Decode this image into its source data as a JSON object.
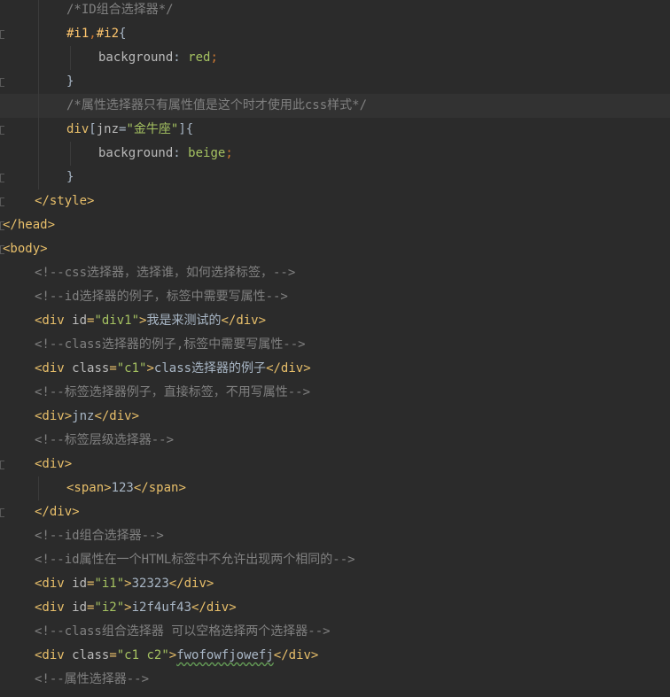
{
  "editor": {
    "lines": [
      {
        "indent": 2,
        "tokens": [
          {
            "t": "comment",
            "v": "/*ID组合选择器*/"
          }
        ]
      },
      {
        "indent": 2,
        "fold": true,
        "tokens": [
          {
            "t": "sel",
            "v": "#i1"
          },
          {
            "t": "punct",
            "v": ","
          },
          {
            "t": "sel",
            "v": "#i2"
          },
          {
            "t": "brace",
            "v": "{"
          }
        ]
      },
      {
        "indent": 3,
        "tokens": [
          {
            "t": "prop",
            "v": "background"
          },
          {
            "t": "text",
            "v": ": "
          },
          {
            "t": "cssval",
            "v": "red"
          },
          {
            "t": "punct",
            "v": ";"
          }
        ]
      },
      {
        "indent": 2,
        "fold": true,
        "tokens": [
          {
            "t": "brace",
            "v": "}"
          }
        ]
      },
      {
        "indent": 2,
        "current": true,
        "tokens": [
          {
            "t": "comment",
            "v": "/*属性选择器只有属性值是这个时才使用此css样式*/"
          }
        ]
      },
      {
        "indent": 2,
        "fold": true,
        "tokens": [
          {
            "t": "tag",
            "v": "div"
          },
          {
            "t": "text",
            "v": "["
          },
          {
            "t": "attr",
            "v": "jnz"
          },
          {
            "t": "text",
            "v": "="
          },
          {
            "t": "val",
            "v": "\"金牛座\""
          },
          {
            "t": "text",
            "v": "]"
          },
          {
            "t": "brace",
            "v": "{"
          }
        ]
      },
      {
        "indent": 3,
        "tokens": [
          {
            "t": "prop",
            "v": "background"
          },
          {
            "t": "text",
            "v": ": "
          },
          {
            "t": "cssval",
            "v": "beige"
          },
          {
            "t": "punct",
            "v": ";"
          }
        ]
      },
      {
        "indent": 2,
        "fold": true,
        "tokens": [
          {
            "t": "brace",
            "v": "}"
          }
        ]
      },
      {
        "indent": 1,
        "fold": true,
        "tokens": [
          {
            "t": "tag",
            "v": "</style>"
          }
        ]
      },
      {
        "indent": 0,
        "fold": true,
        "tokens": [
          {
            "t": "tag",
            "v": "</head>"
          }
        ]
      },
      {
        "indent": 0,
        "fold": true,
        "tokens": [
          {
            "t": "tag",
            "v": "<body>"
          }
        ]
      },
      {
        "indent": 1,
        "tokens": [
          {
            "t": "comment",
            "v": "<!--css选择器，选择谁，如何选择标签，-->"
          }
        ]
      },
      {
        "indent": 1,
        "tokens": [
          {
            "t": "comment",
            "v": "<!--id选择器的例子，标签中需要写属性-->"
          }
        ]
      },
      {
        "indent": 1,
        "tokens": [
          {
            "t": "tag",
            "v": "<div "
          },
          {
            "t": "attr",
            "v": "id"
          },
          {
            "t": "tag",
            "v": "="
          },
          {
            "t": "val",
            "v": "\"div1\""
          },
          {
            "t": "tag",
            "v": ">"
          },
          {
            "t": "text",
            "v": "我是来测试的"
          },
          {
            "t": "tag",
            "v": "</div>"
          }
        ]
      },
      {
        "indent": 1,
        "tokens": [
          {
            "t": "comment",
            "v": "<!--class选择器的例子,标签中需要写属性-->"
          }
        ]
      },
      {
        "indent": 1,
        "tokens": [
          {
            "t": "tag",
            "v": "<div "
          },
          {
            "t": "attr",
            "v": "class"
          },
          {
            "t": "tag",
            "v": "="
          },
          {
            "t": "val",
            "v": "\"c1\""
          },
          {
            "t": "tag",
            "v": ">"
          },
          {
            "t": "text",
            "v": "class选择器的例子"
          },
          {
            "t": "tag",
            "v": "</div>"
          }
        ]
      },
      {
        "indent": 1,
        "tokens": [
          {
            "t": "comment",
            "v": "<!--标签选择器例子，直接标签，不用写属性-->"
          }
        ]
      },
      {
        "indent": 1,
        "tokens": [
          {
            "t": "tag",
            "v": "<div>"
          },
          {
            "t": "text",
            "v": "jnz"
          },
          {
            "t": "tag",
            "v": "</div>"
          }
        ]
      },
      {
        "indent": 1,
        "tokens": [
          {
            "t": "comment",
            "v": "<!--标签层级选择器-->"
          }
        ]
      },
      {
        "indent": 1,
        "fold": true,
        "tokens": [
          {
            "t": "tag",
            "v": "<div>"
          }
        ]
      },
      {
        "indent": 2,
        "tokens": [
          {
            "t": "tag",
            "v": "<span>"
          },
          {
            "t": "text",
            "v": "123"
          },
          {
            "t": "tag",
            "v": "</span>"
          }
        ]
      },
      {
        "indent": 1,
        "fold": true,
        "tokens": [
          {
            "t": "tag",
            "v": "</div>"
          }
        ]
      },
      {
        "indent": 1,
        "tokens": [
          {
            "t": "comment",
            "v": "<!--id组合选择器-->"
          }
        ]
      },
      {
        "indent": 1,
        "tokens": [
          {
            "t": "comment",
            "v": "<!--id属性在一个HTML标签中不允许出现两个相同的-->"
          }
        ]
      },
      {
        "indent": 1,
        "tokens": [
          {
            "t": "tag",
            "v": "<div "
          },
          {
            "t": "attr",
            "v": "id"
          },
          {
            "t": "tag",
            "v": "="
          },
          {
            "t": "val",
            "v": "\"i1\""
          },
          {
            "t": "tag",
            "v": ">"
          },
          {
            "t": "text",
            "v": "32323"
          },
          {
            "t": "tag",
            "v": "</div>"
          }
        ]
      },
      {
        "indent": 1,
        "tokens": [
          {
            "t": "tag",
            "v": "<div "
          },
          {
            "t": "attr",
            "v": "id"
          },
          {
            "t": "tag",
            "v": "="
          },
          {
            "t": "val",
            "v": "\"i2\""
          },
          {
            "t": "tag",
            "v": ">"
          },
          {
            "t": "text",
            "v": "i2f4uf43"
          },
          {
            "t": "tag",
            "v": "</div>"
          }
        ]
      },
      {
        "indent": 1,
        "tokens": [
          {
            "t": "comment",
            "v": "<!--class组合选择器 可以空格选择两个选择器-->"
          }
        ]
      },
      {
        "indent": 1,
        "tokens": [
          {
            "t": "tag",
            "v": "<div "
          },
          {
            "t": "attr",
            "v": "class"
          },
          {
            "t": "tag",
            "v": "="
          },
          {
            "t": "val",
            "v": "\"c1 c2\""
          },
          {
            "t": "tag",
            "v": ">"
          },
          {
            "t": "typo",
            "v": "fwofowfjowefj"
          },
          {
            "t": "tag",
            "v": "</div>"
          }
        ]
      },
      {
        "indent": 1,
        "tokens": [
          {
            "t": "comment",
            "v": "<!--属性选择器-->"
          }
        ]
      }
    ]
  }
}
